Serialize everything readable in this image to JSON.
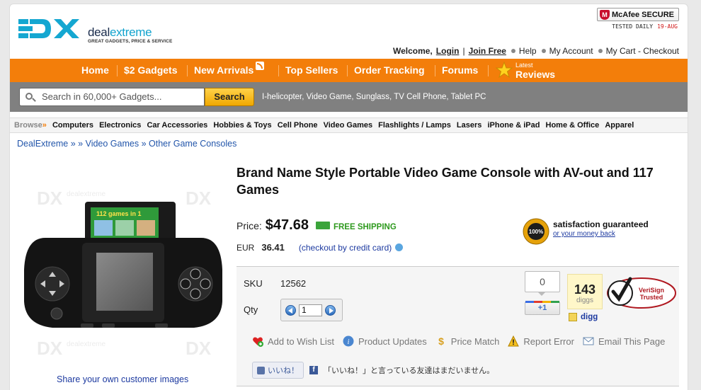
{
  "header": {
    "logo_text_main": "deal",
    "logo_text_accent": "extreme",
    "logo_mark": "DX",
    "logo_tagline": "GREAT GADGETS, PRICE & SERVICE",
    "mcafee_label": "McAfee SECURE",
    "tested_label": "TESTED DAILY",
    "tested_date": "19-AUG",
    "welcome": "Welcome,",
    "login": "Login",
    "divider": "|",
    "join": "Join Free",
    "help": "Help",
    "my_account": "My Account",
    "my_cart": "My Cart - Checkout"
  },
  "nav": {
    "home": "Home",
    "two_dollar": "$2 Gadgets",
    "new_arrivals": "New Arrivals",
    "top_sellers": "Top Sellers",
    "order_tracking": "Order Tracking",
    "forums": "Forums",
    "latest": "Latest",
    "reviews": "Reviews"
  },
  "search": {
    "placeholder": "Search in 60,000+ Gadgets...",
    "button": "Search",
    "popular": "I-helicopter, Video Game, Sunglass, TV Cell Phone, Tablet PC"
  },
  "categories": {
    "browse": "Browse",
    "raquo": "»",
    "items": [
      "Computers",
      "Electronics",
      "Car Accessories",
      "Hobbies & Toys",
      "Cell Phone",
      "Video Games",
      "Flashlights / Lamps",
      "Lasers",
      "iPhone & iPad",
      "Home & Office",
      "Apparel"
    ]
  },
  "breadcrumb": {
    "root": "DealExtreme",
    "sep1": " » » ",
    "level1": "Video Games",
    "sep2": " » ",
    "level2": "Other Game Consoles"
  },
  "product": {
    "watermark": "DX",
    "watermark_small": "dealextreme",
    "cartridge_label": "112 games in 1",
    "share_link": "Share your own customer images",
    "title": "Brand Name Style Portable Video Game Console with AV-out and 117 Games",
    "price_label": "Price:",
    "price": "$47.68",
    "free_shipping": "FREE SHIPPING",
    "eur_label": "EUR",
    "eur_value": "36.41",
    "checkout_note": "(checkout by credit card)",
    "seal_text": "100%",
    "satisfaction": "satisfaction guaranteed",
    "money_back": "or your money back",
    "sku_label": "SKU",
    "sku": "12562",
    "qty_label": "Qty",
    "qty": "1",
    "plusone_count": "0",
    "plusone_label": "+1",
    "digg_count": "143",
    "digg_label": "diggs",
    "digg_link": "digg",
    "verisign_line1": "VeriSign",
    "verisign_line2": "Trusted",
    "wishlist": "Add to Wish List",
    "updates": "Product Updates",
    "price_match": "Price Match",
    "report": "Report Error",
    "email": "Email This Page",
    "fb_like": "いいね！",
    "fb_text": "「いいね！」と言っている友達はまだいません。"
  },
  "colors": {
    "nav_orange": "#f37e0a",
    "search_gray": "#808080",
    "link_blue": "#1d3aa0",
    "free_green": "#2e9a1e"
  }
}
